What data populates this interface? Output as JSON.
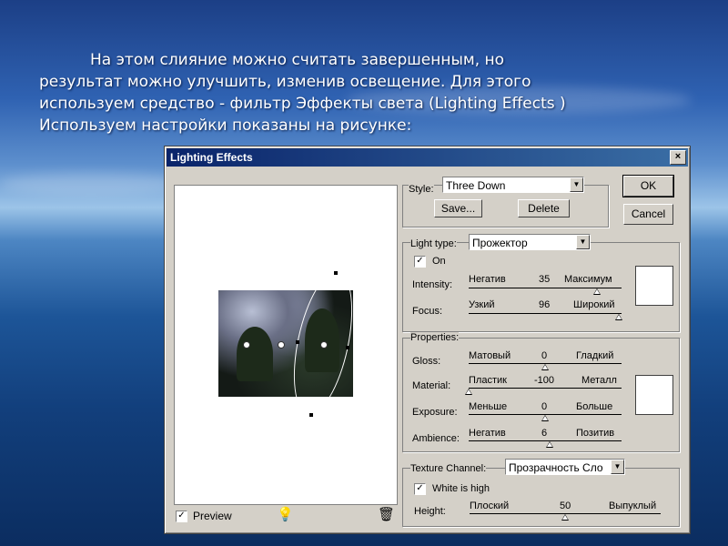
{
  "slide": {
    "line1": "На этом слияние можно считать завершенным, но",
    "line2": "результат можно улучшить, изменив освещение. Для этого",
    "line3": "используем средство - фильтр Эффекты света (Lighting Effects )",
    "line4": "Используем настройки показаны на рисунке:"
  },
  "dialog": {
    "title": "Lighting Effects",
    "close": "×",
    "ok": "OK",
    "cancel": "Cancel",
    "preview_label": "Preview",
    "preview_checked": "✓",
    "style": {
      "label": "Style:",
      "value": "Three Down",
      "save": "Save...",
      "delete": "Delete"
    },
    "light": {
      "type_label": "Light type:",
      "type_value": "Прожектор",
      "on_label": "On",
      "on_checked": "✓",
      "intensity": {
        "label": "Intensity:",
        "min": "Негатив",
        "value": "35",
        "max": "Максимум",
        "fraction": 0.84
      },
      "focus": {
        "label": "Focus:",
        "min": "Узкий",
        "value": "96",
        "max": "Широкий",
        "fraction": 0.98
      }
    },
    "properties": {
      "title": "Properties:",
      "gloss": {
        "label": "Gloss:",
        "min": "Матовый",
        "value": "0",
        "max": "Гладкий",
        "fraction": 0.5
      },
      "material": {
        "label": "Material:",
        "min": "Пластик",
        "value": "-100",
        "max": "Металл",
        "fraction": 0.0
      },
      "exposure": {
        "label": "Exposure:",
        "min": "Меньше",
        "value": "0",
        "max": "Больше",
        "fraction": 0.5
      },
      "ambience": {
        "label": "Ambience:",
        "min": "Негатив",
        "value": "6",
        "max": "Позитив",
        "fraction": 0.53
      }
    },
    "texture": {
      "channel_label": "Texture Channel:",
      "channel_value": "Прозрачность Сло",
      "white_high_label": "White is high",
      "white_high_checked": "✓",
      "height": {
        "label": "Height:",
        "min": "Плоский",
        "value": "50",
        "max": "Выпуклый",
        "fraction": 0.5
      }
    },
    "icons": {
      "arrow": "▼",
      "bulb": "💡",
      "trash": "🗑"
    }
  }
}
